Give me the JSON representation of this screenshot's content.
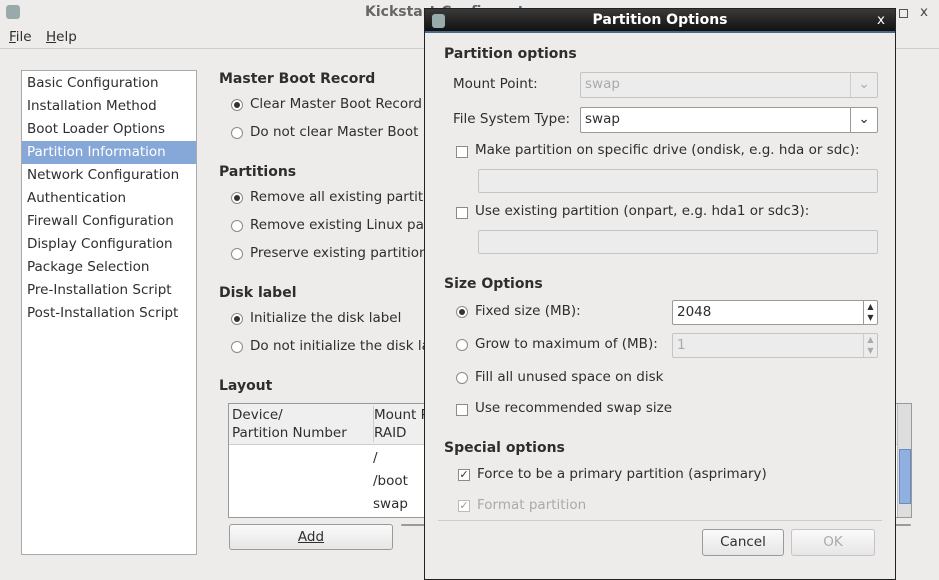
{
  "window": {
    "title": "Kickstart Configurator"
  },
  "menu": [
    "File",
    "Help"
  ],
  "sidebar": {
    "items": [
      "Basic Configuration",
      "Installation Method",
      "Boot Loader Options",
      "Partition Information",
      "Network Configuration",
      "Authentication",
      "Firewall Configuration",
      "Display Configuration",
      "Package Selection",
      "Pre-Installation Script",
      "Post-Installation Script"
    ],
    "selected": "Partition Information"
  },
  "main": {
    "mbr": {
      "title": "Master Boot Record",
      "options": [
        "Clear Master Boot Record",
        "Do not clear Master Boot Record"
      ],
      "selected": 0
    },
    "partitions": {
      "title": "Partitions",
      "options": [
        "Remove all existing partitions",
        "Remove existing Linux partitions",
        "Preserve existing partitions"
      ],
      "selected": 0
    },
    "disklabel": {
      "title": "Disk label",
      "options": [
        "Initialize the disk label",
        "Do not initialize the disk label"
      ],
      "selected": 0
    },
    "layout": {
      "title": "Layout",
      "columns": [
        "Device/\nPartition Number",
        "Mount Point/\nRAID"
      ],
      "rows": [
        [
          "",
          "/"
        ],
        [
          "",
          "/boot"
        ],
        [
          "",
          "swap"
        ]
      ]
    },
    "add_label": "Add"
  },
  "dialog": {
    "title": "Partition Options",
    "partition_options_title": "Partition options",
    "mount_point_label": "Mount Point:",
    "mount_point_value": "swap",
    "fs_type_label": "File System Type:",
    "fs_type_value": "swap",
    "ondisk_label": "Make partition on specific drive (ondisk, e.g. hda or sdc):",
    "ondisk_checked": false,
    "ondisk_value": "",
    "onpart_label": "Use existing partition (onpart, e.g. hda1 or sdc3):",
    "onpart_checked": false,
    "onpart_value": "",
    "size_title": "Size Options",
    "fixed_label": "Fixed size (MB):",
    "fixed_value": "2048",
    "grow_label": "Grow to maximum of (MB):",
    "grow_value": "1",
    "fill_label": "Fill all unused space on disk",
    "size_selected": "fixed",
    "recommended_label": "Use recommended swap size",
    "recommended_checked": false,
    "special_title": "Special options",
    "primary_label": "Force to be a primary partition (asprimary)",
    "primary_checked": true,
    "format_label": "Format partition",
    "format_checked": true,
    "cancel_label": "Cancel",
    "ok_label": "OK"
  }
}
